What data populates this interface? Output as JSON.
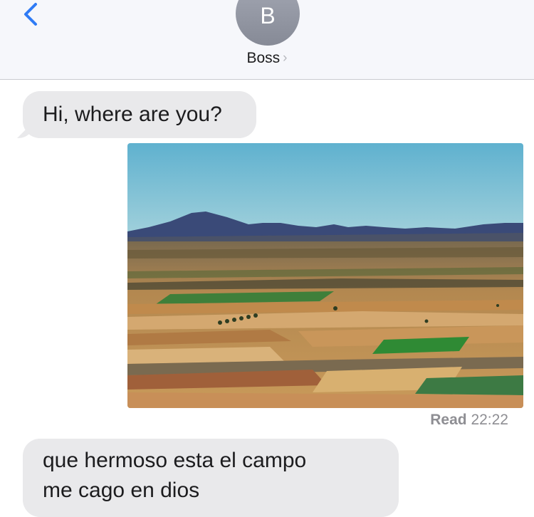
{
  "header": {
    "back_icon": "chevron-left-icon",
    "avatar_initial": "B",
    "contact_name": "Boss",
    "chevron": "›",
    "accent_color": "#2f7bf5"
  },
  "messages": [
    {
      "direction": "incoming",
      "type": "text",
      "lines": [
        "Hi, where are you?"
      ]
    },
    {
      "direction": "outgoing",
      "type": "image",
      "description_icon": "landscape-photo"
    },
    {
      "direction": "incoming",
      "type": "text",
      "lines": [
        "que hermoso esta el campo",
        "me cago en dios"
      ]
    }
  ],
  "receipt": {
    "label": "Read",
    "time": "22:22"
  },
  "colors": {
    "incoming_bubble": "#e9e9eb",
    "header_bg": "#f6f7fb",
    "receipt_text": "#8e8e93"
  }
}
